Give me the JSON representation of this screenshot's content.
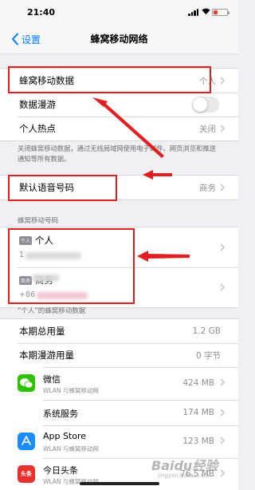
{
  "status_bar": {
    "time": "21:40"
  },
  "nav": {
    "back_label": "设置",
    "title": "蜂窝移动网络"
  },
  "main_group": {
    "cellular_data": {
      "label": "蜂窝移动数据",
      "value": "个人"
    },
    "data_roaming": {
      "label": "数据漫游",
      "enabled": false
    },
    "hotspot": {
      "label": "个人热点",
      "value": "关闭"
    }
  },
  "footnote": "关闭蜂窝移动数据，通过无线局域网使用电子邮件、网页浏览和推送通知等所有数据。",
  "default_voice": {
    "label": "默认语音号码",
    "value": "商务"
  },
  "sim_section": {
    "header": "蜂窝移动号码",
    "lines": [
      {
        "badge": "个人",
        "name": "个人",
        "number": "1"
      },
      {
        "badge": "商务",
        "name": "商务",
        "number": "+86"
      }
    ]
  },
  "usage_section": {
    "header": "“个人”的蜂窝移动数据",
    "total": {
      "label": "本期总用量",
      "value": "1.2 GB"
    },
    "roaming": {
      "label": "本期漫游用量",
      "value": "0 字节"
    }
  },
  "apps": [
    {
      "name": "微信",
      "sub": "WLAN 与蜂窝移动网",
      "size": "424 MB",
      "icon": "wechat-icon",
      "color": "#2dc100",
      "enabled": true
    },
    {
      "name": "系统服务",
      "sub": "",
      "size": "174 MB",
      "icon": "",
      "color": "",
      "enabled": null
    },
    {
      "name": "App Store",
      "sub": "WLAN 与蜂窝移动网",
      "size": "123 MB",
      "icon": "app-store-icon",
      "color": "#1a8cff",
      "enabled": true
    },
    {
      "name": "今日头条",
      "sub": "WLAN 与蜂窝移动网",
      "size": "76.5 MB",
      "icon": "toutiao-icon",
      "color": "#e8312f",
      "icon_text": "头条",
      "enabled": true
    }
  ],
  "watermark": {
    "brand": "Baidu经验",
    "sub": "jingyan.baidu.com"
  },
  "colors": {
    "accent": "#007aff",
    "annotation": "#e02020",
    "switch_on": "#4cd964",
    "background": "#efeff4"
  }
}
